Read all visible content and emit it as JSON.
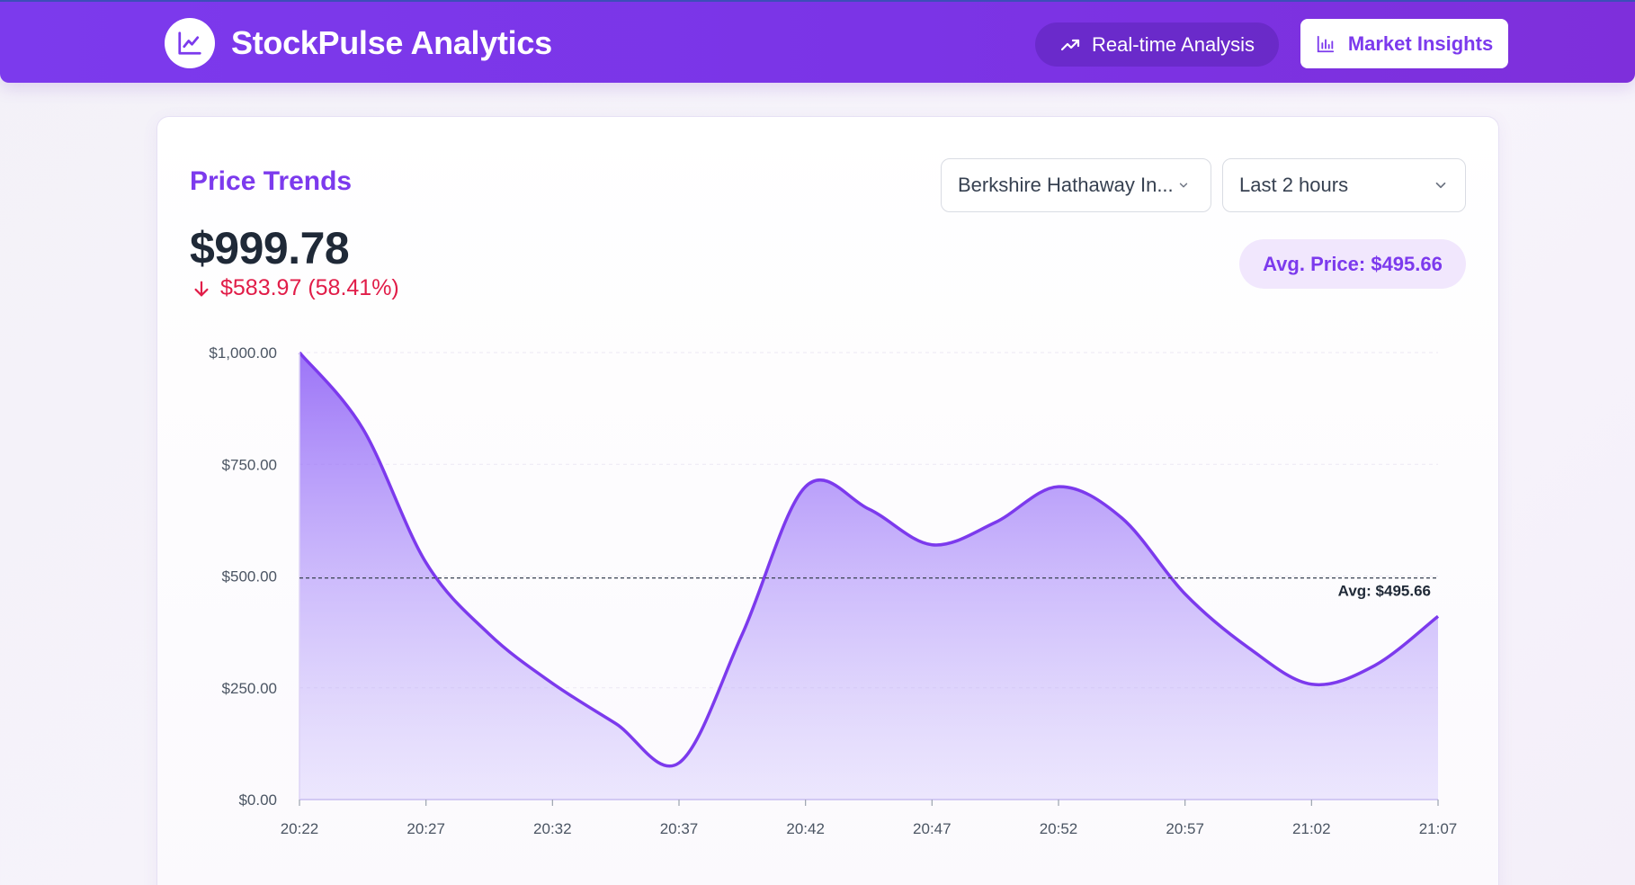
{
  "app": {
    "title": "StockPulse Analytics",
    "logo_icon": "line-chart-icon"
  },
  "header": {
    "realtime_label": "Real-time Analysis",
    "realtime_icon": "trending-up-icon",
    "insights_label": "Market Insights",
    "insights_icon": "bar-chart-icon"
  },
  "panel": {
    "title": "Price Trends",
    "price": "$999.78",
    "change": "$583.97 (58.41%)",
    "change_direction": "down",
    "stock_select": "Berkshire Hathaway In...",
    "range_select": "Last 2 hours",
    "avg_pill": "Avg. Price: $495.66"
  },
  "colors": {
    "accent": "#7c3aed",
    "negative": "#e11d48"
  },
  "chart_data": {
    "type": "area",
    "x": [
      "20:22",
      "20:27",
      "20:32",
      "20:37",
      "20:42",
      "20:47",
      "20:52",
      "20:57",
      "21:02",
      "21:07"
    ],
    "y_ticks": [
      "$0.00",
      "$250.00",
      "$500.00",
      "$750.00",
      "$1,000.00"
    ],
    "ylim": [
      0,
      1000
    ],
    "points": [
      {
        "t": 0,
        "v": 1000
      },
      {
        "t": 2.5,
        "v": 830
      },
      {
        "t": 5,
        "v": 530
      },
      {
        "t": 7.5,
        "v": 370
      },
      {
        "t": 10,
        "v": 260
      },
      {
        "t": 12.5,
        "v": 170
      },
      {
        "t": 15,
        "v": 82
      },
      {
        "t": 17.5,
        "v": 370
      },
      {
        "t": 20,
        "v": 700
      },
      {
        "t": 22.5,
        "v": 650
      },
      {
        "t": 25,
        "v": 570
      },
      {
        "t": 27.5,
        "v": 620
      },
      {
        "t": 30,
        "v": 700
      },
      {
        "t": 32.5,
        "v": 630
      },
      {
        "t": 35,
        "v": 460
      },
      {
        "t": 37.5,
        "v": 340
      },
      {
        "t": 40,
        "v": 258
      },
      {
        "t": 42.5,
        "v": 300
      },
      {
        "t": 45,
        "v": 410
      }
    ],
    "average": 495.66,
    "average_label": "Avg: $495.66",
    "grid": true
  }
}
